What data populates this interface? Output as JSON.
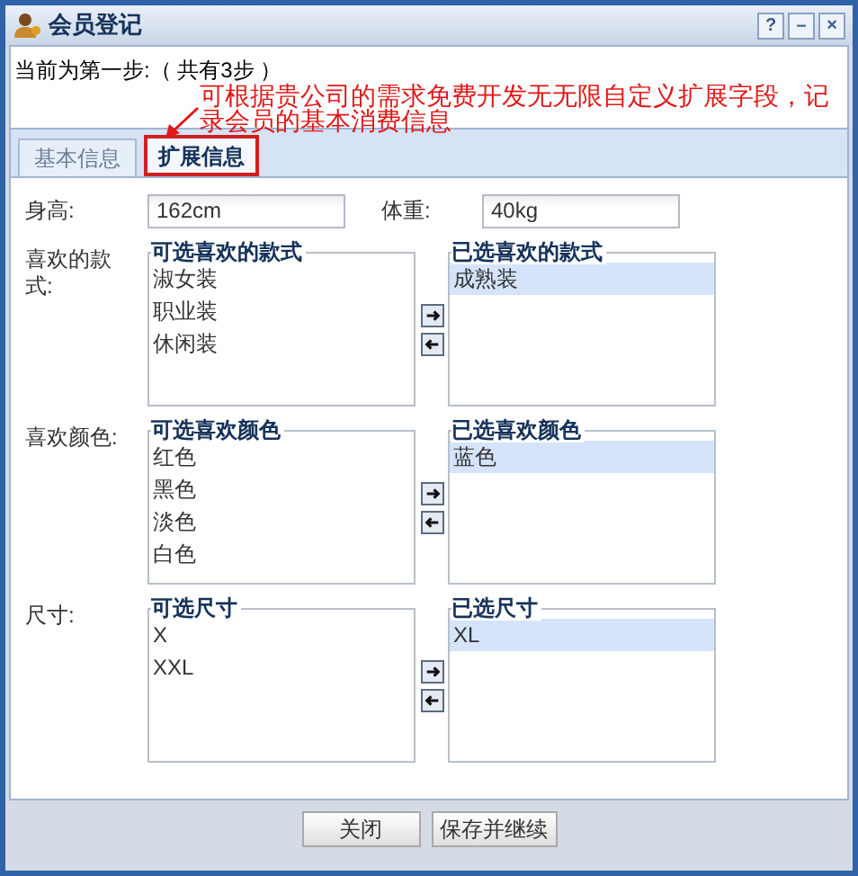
{
  "window": {
    "title": "会员登记",
    "controls": [
      "?",
      "–",
      "×"
    ]
  },
  "step_text": "当前为第一步:（ 共有3步 ）",
  "annotation": {
    "lines": [
      "可根据贵公司的需求免费开发无无限自定义扩展字段，记",
      "录会员的基本消费信息"
    ]
  },
  "tabs": [
    {
      "label": "基本信息",
      "selected": false
    },
    {
      "label": "扩展信息",
      "selected": true
    }
  ],
  "fields": [
    {
      "label": "身高:",
      "value": "162cm"
    },
    {
      "label": "体重:",
      "value": "40kg"
    }
  ],
  "pickers": [
    {
      "label": "喜欢的款式:",
      "available": {
        "legend": "可选喜欢的款式",
        "items": [
          {
            "label": "淑女装",
            "selected": false
          },
          {
            "label": "职业装",
            "selected": false
          },
          {
            "label": "休闲装",
            "selected": false
          }
        ]
      },
      "chosen": {
        "legend": "已选喜欢的款式",
        "items": [
          {
            "label": "成熟装",
            "selected": true
          }
        ]
      }
    },
    {
      "label": "喜欢颜色:",
      "available": {
        "legend": "可选喜欢颜色",
        "items": [
          {
            "label": "红色",
            "selected": false
          },
          {
            "label": "黑色",
            "selected": false
          },
          {
            "label": "淡色",
            "selected": false
          },
          {
            "label": "白色",
            "selected": false
          }
        ]
      },
      "chosen": {
        "legend": "已选喜欢颜色",
        "items": [
          {
            "label": "蓝色",
            "selected": true
          }
        ]
      }
    },
    {
      "label": "尺寸:",
      "available": {
        "legend": "可选尺寸",
        "items": [
          {
            "label": "X",
            "selected": false
          },
          {
            "label": "XXL",
            "selected": false
          }
        ]
      },
      "chosen": {
        "legend": "已选尺寸",
        "items": [
          {
            "label": "XL",
            "selected": true
          }
        ]
      }
    }
  ],
  "buttons": [
    "关闭",
    "保存并继续"
  ]
}
